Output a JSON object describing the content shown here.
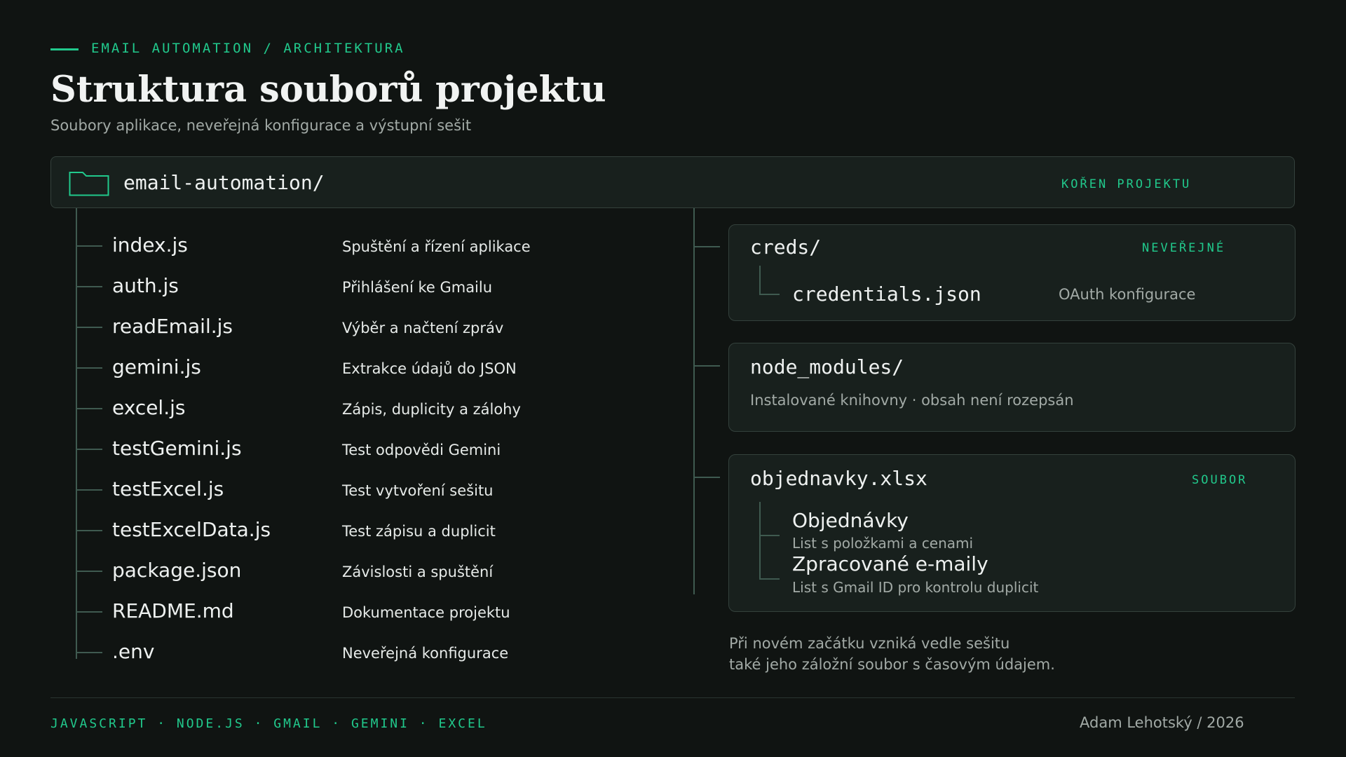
{
  "header": {
    "kicker": "EMAIL AUTOMATION / ARCHITEKTURA",
    "title": "Struktura souborů projektu",
    "subtitle": "Soubory aplikace, neveřejná konfigurace a výstupní sešit"
  },
  "root": {
    "icon": "folder-icon",
    "name": "email-automation/",
    "badge": "KOŘEN PROJEKTU"
  },
  "files": [
    {
      "name": "index.js",
      "desc": "Spuštění a řízení aplikace"
    },
    {
      "name": "auth.js",
      "desc": "Přihlášení ke Gmailu"
    },
    {
      "name": "readEmail.js",
      "desc": "Výběr a načtení zpráv"
    },
    {
      "name": "gemini.js",
      "desc": "Extrakce údajů do JSON"
    },
    {
      "name": "excel.js",
      "desc": "Zápis, duplicity a zálohy"
    },
    {
      "name": "testGemini.js",
      "desc": "Test odpovědi Gemini"
    },
    {
      "name": "testExcel.js",
      "desc": "Test vytvoření sešitu"
    },
    {
      "name": "testExcelData.js",
      "desc": "Test zápisu a duplicit"
    },
    {
      "name": "package.json",
      "desc": "Závislosti a spuštění"
    },
    {
      "name": "README.md",
      "desc": "Dokumentace projektu"
    },
    {
      "name": ".env",
      "desc": "Neveřejná konfigurace"
    }
  ],
  "creds": {
    "name": "creds/",
    "badge": "NEVEŘEJNÉ",
    "child": "credentials.json",
    "child_desc": "OAuth konfigurace"
  },
  "node_modules": {
    "name": "node_modules/",
    "desc": "Instalované knihovny · obsah není rozepsán"
  },
  "workbook": {
    "name": "objednavky.xlsx",
    "badge": "SOUBOR",
    "sheets": [
      {
        "name": "Objednávky",
        "desc": "List s položkami a cenami"
      },
      {
        "name": "Zpracované e-maily",
        "desc": "List s Gmail ID pro kontrolu duplicit"
      }
    ]
  },
  "note": {
    "line1": "Při novém začátku vzniká vedle sešitu",
    "line2": "také jeho záložní soubor s časovým údajem."
  },
  "footer": {
    "tags": "JAVASCRIPT · NODE.JS · GMAIL · GEMINI · EXCEL",
    "author": "Adam Lehotský / 2026"
  },
  "colors": {
    "background": "#101412",
    "accent": "#21c98c",
    "panel": "#18201d",
    "border": "#34413c",
    "tree_line": "#3f5a50"
  }
}
